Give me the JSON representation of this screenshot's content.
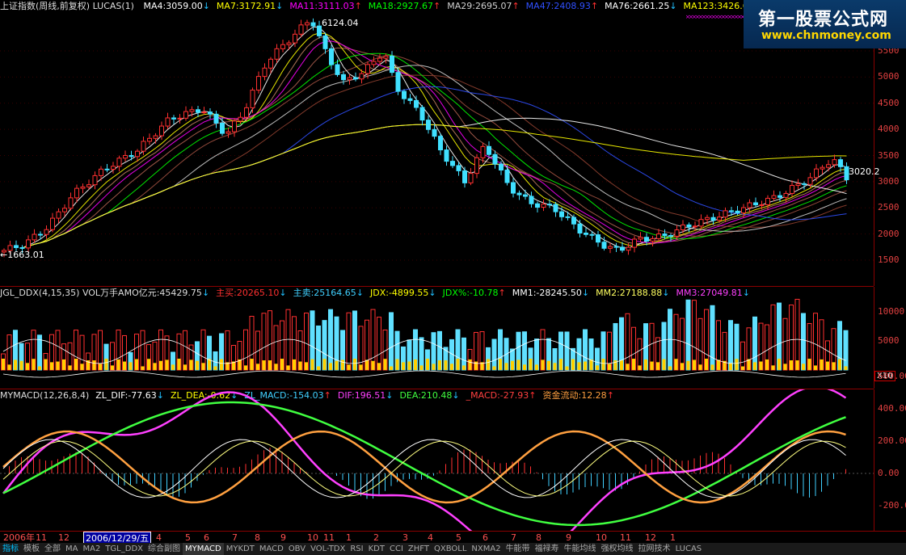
{
  "main_panel": {
    "title": "上证指数(周线,前复权) LUCAS(1)",
    "ma_labels": [
      {
        "text": "MA4:3059.00",
        "arrow": "↓",
        "color": "#ffffff"
      },
      {
        "text": "MA7:3172.91",
        "arrow": "↓",
        "color": "#ffff00"
      },
      {
        "text": "MA11:3111.03",
        "arrow": "↑",
        "color": "#ff00ff"
      },
      {
        "text": "MA18:2927.67",
        "arrow": "↑",
        "color": "#00ff00"
      },
      {
        "text": "MA29:2695.07",
        "arrow": "↑",
        "color": "#d0d0d0"
      },
      {
        "text": "MA47:2408.93",
        "arrow": "↑",
        "color": "#3050ff"
      },
      {
        "text": "MA76:2661.25",
        "arrow": "↓",
        "color": "#ffffff"
      },
      {
        "text": "MA123:3426.62",
        "arrow": "↓",
        "color": "#ffff00"
      }
    ],
    "high_label": "6124.04",
    "low_label": "1663.01",
    "last_label": "3020.2",
    "y_ticks": [
      "5500",
      "5000",
      "4500",
      "4000",
      "3500",
      "3000",
      "2500",
      "2000",
      "1500"
    ]
  },
  "vol_panel": {
    "labels": [
      {
        "text": "JGL_DDX(4,15,35) VOL万手AMO亿元:45429.75",
        "arrow": "↓",
        "color": "#dddddd"
      },
      {
        "text": "主买:20265.10",
        "arrow": "↓",
        "color": "#ff3030"
      },
      {
        "text": "主卖:25164.65",
        "arrow": "↓",
        "color": "#40d0ff"
      },
      {
        "text": "JDX:-4899.55",
        "arrow": "↓",
        "color": "#ffff00"
      },
      {
        "text": "JDX%:-10.78",
        "arrow": "↑",
        "color": "#00ff00"
      },
      {
        "text": "MM1:-28245.50",
        "arrow": "↓",
        "color": "#ffffff"
      },
      {
        "text": "MM2:27188.88",
        "arrow": "↓",
        "color": "#ffff60"
      },
      {
        "text": "MM3:27049.81",
        "arrow": "↓",
        "color": "#ff40ff"
      }
    ],
    "y_ticks": [
      "10000",
      "5000"
    ],
    "scale_label": "X10"
  },
  "macd_panel": {
    "labels": [
      {
        "text": "MYMACD(12,26,8,4)",
        "arrow": "",
        "color": "#dddddd"
      },
      {
        "text": "ZL_DIF:-77.63",
        "arrow": "↓",
        "color": "#ffffff"
      },
      {
        "text": "ZL_DEA:-0.62",
        "arrow": "↓",
        "color": "#ffff00"
      },
      {
        "text": "ZL_MACD:-154.03",
        "arrow": "↑",
        "color": "#40d0ff"
      },
      {
        "text": "DIF:196.51",
        "arrow": "↓",
        "color": "#ff40ff"
      },
      {
        "text": "DEA:210.48",
        "arrow": "↓",
        "color": "#40ff40"
      },
      {
        "text": "_MACD:-27.93",
        "arrow": "↑",
        "color": "#ff4040"
      },
      {
        "text": "资金流动:12.28",
        "arrow": "↑",
        "color": "#ffa040"
      }
    ],
    "y_ticks": [
      "600.00",
      "400.00",
      "200.00",
      "0.00",
      "-200.00"
    ]
  },
  "watermark": {
    "title": "第一股票公式网",
    "url": "www.chnmoney.com"
  },
  "time_axis": {
    "labels": [
      "2006年",
      "11",
      "12",
      "2006/12/29/五",
      "4",
      "5",
      "6",
      "7",
      "8",
      "9",
      "10",
      "11",
      "1",
      "2",
      "3",
      "4",
      "5",
      "6",
      "7",
      "8",
      "9",
      "10",
      "11",
      "12",
      "1"
    ]
  },
  "tabs": [
    "指标",
    "模板",
    "全部",
    "MA",
    "MA2",
    "TGL_DDX",
    "综合副图",
    "MYMACD",
    "MYKDT",
    "MACD",
    "OBV",
    "VOL-TDX",
    "RSI",
    "KDT",
    "CCI",
    "ZHFT",
    "QXBOLL",
    "NXMA2",
    "牛能带",
    "福禄寿",
    "牛能均线",
    "强权均线",
    "拉网技术",
    "LUCAS"
  ],
  "active_tab": "MYMACD"
}
